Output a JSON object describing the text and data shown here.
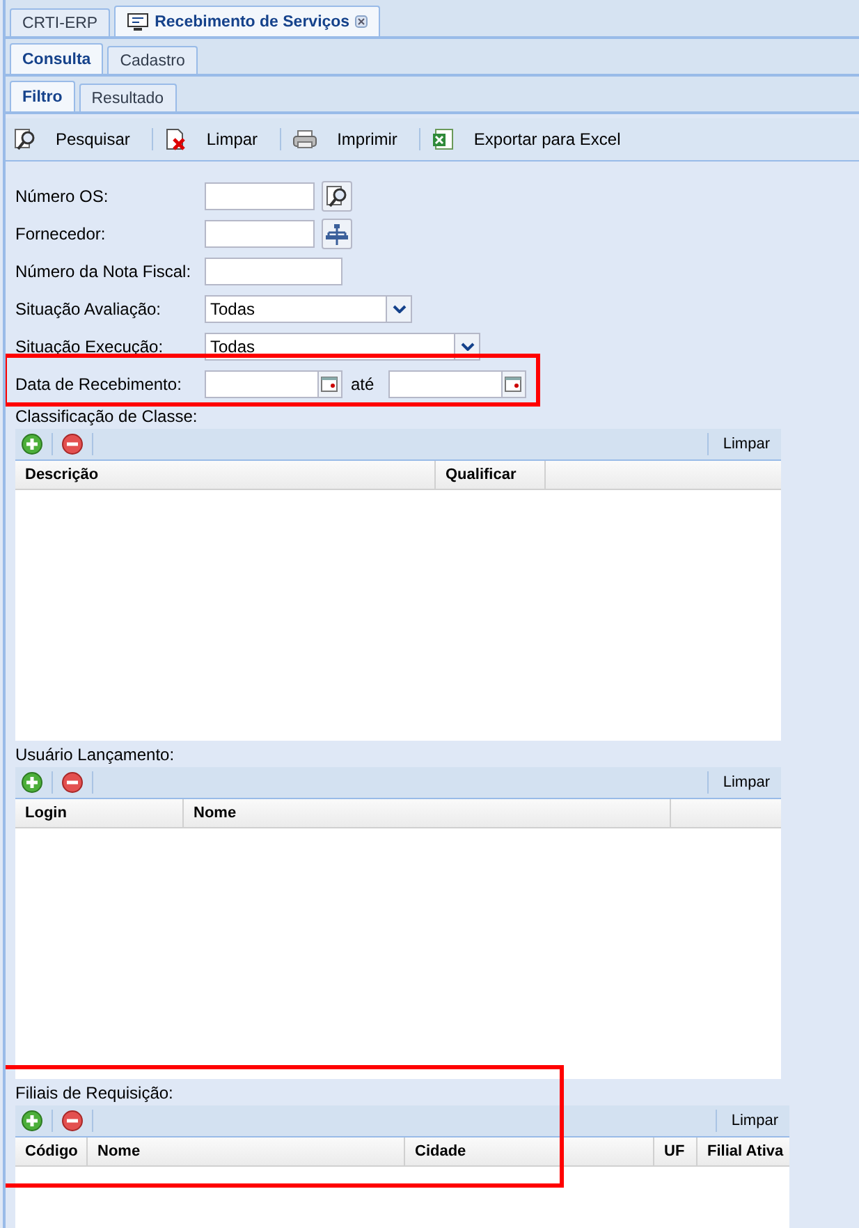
{
  "window_tabs": [
    {
      "label": "CRTI-ERP",
      "selected": false
    },
    {
      "label": "Recebimento de Serviços",
      "selected": true
    }
  ],
  "tabs": [
    {
      "label": "Consulta",
      "selected": true
    },
    {
      "label": "Cadastro",
      "selected": false
    }
  ],
  "subtabs": [
    {
      "label": "Filtro",
      "selected": true
    },
    {
      "label": "Resultado",
      "selected": false
    }
  ],
  "toolbar": [
    {
      "label": "Pesquisar"
    },
    {
      "label": "Limpar"
    },
    {
      "label": "Imprimir"
    },
    {
      "label": "Exportar para Excel"
    }
  ],
  "fields": [
    {
      "label": "Número OS:",
      "kind": "lookup"
    },
    {
      "label": "Fornecedor:",
      "kind": "lookup"
    },
    {
      "label": "Número da Nota Fiscal:",
      "kind": "text"
    },
    {
      "label": "Situação Avaliação:",
      "kind": "select",
      "value": "Todas"
    },
    {
      "label": "Situação Execução:",
      "kind": "select",
      "value": "Todas"
    },
    {
      "label": "Data de Recebimento:",
      "kind": "daterange",
      "separator": "até",
      "highlighted": true
    }
  ],
  "grids": [
    {
      "title": "Classificação de Classe:",
      "clear_label": "Limpar",
      "highlighted": false,
      "columns": [
        "Descrição",
        "Qualificar",
        ""
      ]
    },
    {
      "title": "Usuário Lançamento:",
      "clear_label": "Limpar",
      "highlighted": false,
      "columns": [
        "Login",
        "Nome",
        ""
      ]
    },
    {
      "title": "Filiais de Requisição:",
      "clear_label": "Limpar",
      "highlighted": true,
      "columns": [
        "Código",
        "Nome",
        "Cidade",
        "UF",
        "Filial Ativa"
      ]
    }
  ]
}
